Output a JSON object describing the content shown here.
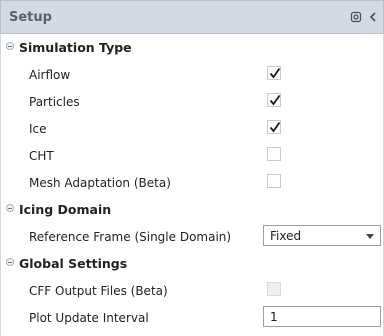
{
  "header": {
    "title": "Setup"
  },
  "sections": [
    {
      "label": "Simulation Type"
    },
    {
      "label": "Icing Domain"
    },
    {
      "label": "Global Settings"
    }
  ],
  "simulation_type": {
    "airflow": {
      "label": "Airflow",
      "checked": true
    },
    "particles": {
      "label": "Particles",
      "checked": true
    },
    "ice": {
      "label": "Ice",
      "checked": true
    },
    "cht": {
      "label": "CHT",
      "checked": false
    },
    "mesh_adaptation": {
      "label": "Mesh Adaptation (Beta)",
      "checked": false
    }
  },
  "icing_domain": {
    "reference_frame": {
      "label": "Reference Frame (Single Domain)",
      "value": "Fixed"
    }
  },
  "global_settings": {
    "cff_output": {
      "label": "CFF Output Files (Beta)",
      "checked": false,
      "disabled": true
    },
    "plot_update_interval": {
      "label": "Plot Update Interval",
      "value": "1"
    }
  },
  "colors": {
    "header_bg": "#d3dae3",
    "title_text": "#58616c",
    "check_mark": "#1a1a1a"
  },
  "icons": [
    "pin-icon",
    "collapse-chevron-icon",
    "section-collapse-icon",
    "check-icon",
    "dropdown-arrow-icon"
  ]
}
